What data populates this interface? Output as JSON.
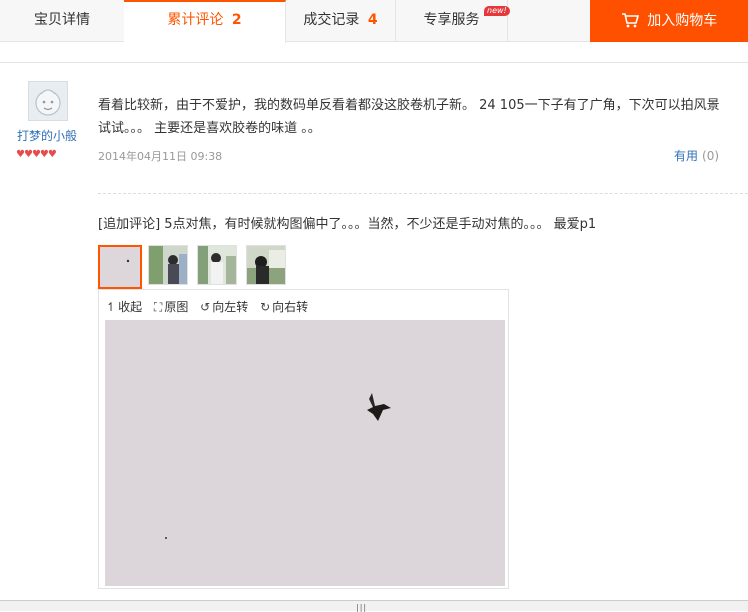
{
  "tabs": [
    {
      "label": "宝贝详情",
      "count": ""
    },
    {
      "label": "累计评论",
      "count": "2"
    },
    {
      "label": "成交记录",
      "count": "4"
    },
    {
      "label": "专享服务",
      "count": ""
    }
  ],
  "new_badge": "new!",
  "cart_label": "加入购物车",
  "review": {
    "username": "打梦的小般",
    "rank_icon": "heart-diamond-icons",
    "text": "看着比较新，由于不爱护，我的数码单反看着都没这胶卷机子新。 24 105一下子有了广角，下次可以拍风景试试。。。 主要还是喜欢胶卷的味道 。。",
    "date": "2014年04月11日 09:38",
    "useful_label": "有用",
    "useful_count": "(0)",
    "append_text": "[追加评论] 5点对焦，有时候就构图偏中了。。。当然，不少还是手动对焦的。。。 最爱p1"
  },
  "viewer": {
    "collapse_label": "收起",
    "original_label": "原图",
    "rotate_left_label": "向左转",
    "rotate_right_label": "向右转"
  },
  "colors": {
    "accent": "#ff5500",
    "cart_bg": "#ff5000",
    "link": "#3070b7"
  }
}
